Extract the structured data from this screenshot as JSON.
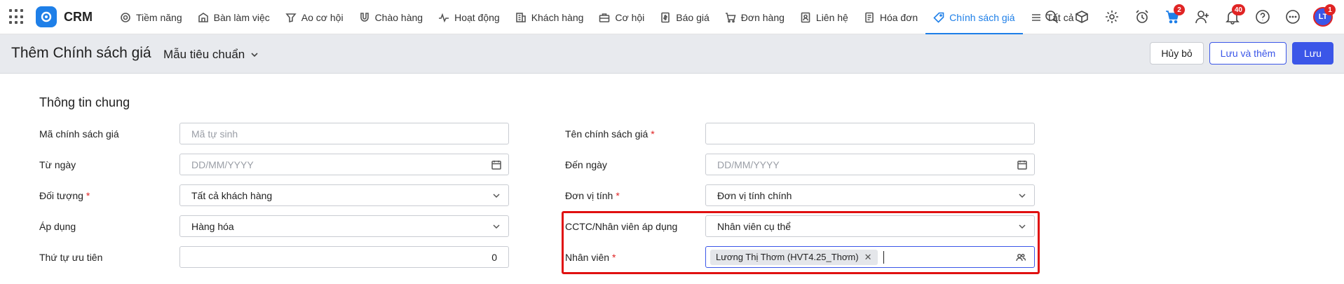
{
  "app": {
    "name": "CRM"
  },
  "nav": {
    "items": [
      {
        "label": "Tiềm năng",
        "icon": "target-icon"
      },
      {
        "label": "Bàn làm việc",
        "icon": "desk-icon"
      },
      {
        "label": "Ao cơ hội",
        "icon": "funnel-icon"
      },
      {
        "label": "Chào hàng",
        "icon": "magnet-icon"
      },
      {
        "label": "Hoạt động",
        "icon": "activity-icon"
      },
      {
        "label": "Khách hàng",
        "icon": "building-icon"
      },
      {
        "label": "Cơ hội",
        "icon": "briefcase-icon"
      },
      {
        "label": "Báo giá",
        "icon": "quote-icon"
      },
      {
        "label": "Đơn hàng",
        "icon": "cart-icon"
      },
      {
        "label": "Liên hệ",
        "icon": "contact-icon"
      },
      {
        "label": "Hóa đơn",
        "icon": "invoice-icon"
      },
      {
        "label": "Chính sách giá",
        "icon": "price-tag-icon",
        "active": true
      },
      {
        "label": "Tất cả",
        "icon": "menu-icon"
      }
    ]
  },
  "tools": {
    "cart_badge": "2",
    "notification_badge": "40",
    "avatar_initials": "LT",
    "avatar_badge": "1"
  },
  "header": {
    "title": "Thêm Chính sách giá",
    "template": "Mẫu tiêu chuẩn",
    "cancel_label": "Hủy bỏ",
    "save_add_label": "Lưu và thêm",
    "save_label": "Lưu"
  },
  "form": {
    "section_title": "Thông tin chung",
    "code": {
      "label": "Mã chính sách giá",
      "placeholder": "Mã tự sinh"
    },
    "name": {
      "label": "Tên chính sách giá",
      "value": ""
    },
    "from_date": {
      "label": "Từ ngày",
      "placeholder": "DD/MM/YYYY"
    },
    "to_date": {
      "label": "Đến ngày",
      "placeholder": "DD/MM/YYYY"
    },
    "target": {
      "label": "Đối tượng",
      "value": "Tất cả khách hàng"
    },
    "unit": {
      "label": "Đơn vị tính",
      "value": "Đơn vị tính chính"
    },
    "apply": {
      "label": "Áp dụng",
      "value": "Hàng hóa"
    },
    "scope": {
      "label": "CCTC/Nhân viên áp dụng",
      "value": "Nhân viên cụ thể"
    },
    "priority": {
      "label": "Thứ tự ưu tiên",
      "value": "0"
    },
    "employee": {
      "label": "Nhân viên",
      "tag": "Lương Thị Thơm (HVT4.25_Thơm)"
    }
  },
  "colors": {
    "accent": "#1e7fe8",
    "primary_button": "#3b56e8",
    "highlight": "#e01010",
    "required": "#e02424"
  }
}
